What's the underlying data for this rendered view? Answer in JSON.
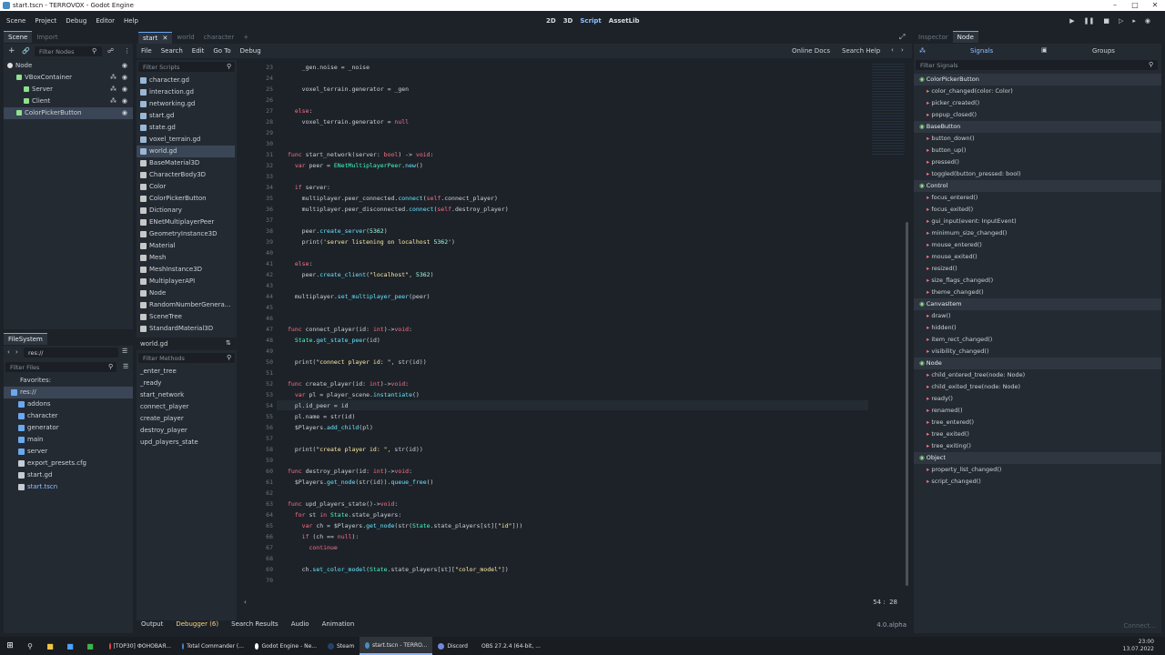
{
  "window": {
    "title": "start.tscn - TERROVOX - Godot Engine"
  },
  "menu": {
    "items": [
      "Scene",
      "Project",
      "Debug",
      "Editor",
      "Help"
    ]
  },
  "modes": [
    "2D",
    "3D",
    "Script",
    "AssetLib"
  ],
  "scene_dock": {
    "tabs": [
      "Scene",
      "Import"
    ],
    "filter_placeholder": "Filter Nodes",
    "nodes": [
      "Node",
      "VBoxContainer",
      "Server",
      "Client",
      "ColorPickerButton"
    ]
  },
  "filesystem": {
    "title": "FileSystem",
    "path": "res://",
    "filter_placeholder": "Filter Files",
    "items": [
      "Favorites:",
      "res://",
      "addons",
      "character",
      "generator",
      "main",
      "server",
      "export_presets.cfg",
      "start.gd",
      "start.tscn"
    ]
  },
  "editor_tabs": [
    "start",
    "world",
    "character"
  ],
  "script_menu": [
    "File",
    "Search",
    "Edit",
    "Go To",
    "Debug"
  ],
  "script_links": {
    "docs": "Online Docs",
    "help": "Search Help"
  },
  "script_list": {
    "filter_placeholder": "Filter Scripts",
    "items": [
      "character.gd",
      "interaction.gd",
      "networking.gd",
      "start.gd",
      "state.gd",
      "voxel_terrain.gd",
      "world.gd",
      "BaseMaterial3D",
      "CharacterBody3D",
      "Color",
      "ColorPickerButton",
      "Dictionary",
      "ENetMultiplayerPeer",
      "GeometryInstance3D",
      "Material",
      "Mesh",
      "MeshInstance3D",
      "MultiplayerAPI",
      "Node",
      "RandomNumberGenera...",
      "SceneTree",
      "StandardMaterial3D"
    ],
    "current": "world.gd"
  },
  "method_list": {
    "filter_placeholder": "Filter Methods",
    "items": [
      "_enter_tree",
      "_ready",
      "start_network",
      "connect_player",
      "create_player",
      "destroy_player",
      "upd_players_state"
    ]
  },
  "code": {
    "lines": [
      {
        "n": "23",
        "t": "    _gen.noise = _noise"
      },
      {
        "n": "24",
        "t": ""
      },
      {
        "n": "25",
        "t": "    voxel_terrain.generator = _gen"
      },
      {
        "n": "26",
        "t": ""
      },
      {
        "n": "27",
        "t": "  else:"
      },
      {
        "n": "28",
        "t": "    voxel_terrain.generator = null"
      },
      {
        "n": "29",
        "t": ""
      },
      {
        "n": "30",
        "t": ""
      },
      {
        "n": "31",
        "t": "func start_network(server: bool) -> void:"
      },
      {
        "n": "32",
        "t": "  var peer = ENetMultiplayerPeer.new()"
      },
      {
        "n": "33",
        "t": ""
      },
      {
        "n": "34",
        "t": "  if server:"
      },
      {
        "n": "35",
        "t": "    multiplayer.peer_connected.connect(self.connect_player)"
      },
      {
        "n": "36",
        "t": "    multiplayer.peer_disconnected.connect(self.destroy_player)"
      },
      {
        "n": "37",
        "t": ""
      },
      {
        "n": "38",
        "t": "    peer.create_server(5362)"
      },
      {
        "n": "39",
        "t": "    print('server listening on localhost 5362')"
      },
      {
        "n": "40",
        "t": ""
      },
      {
        "n": "41",
        "t": "  else:"
      },
      {
        "n": "42",
        "t": "    peer.create_client(\"localhost\", 5362)"
      },
      {
        "n": "43",
        "t": ""
      },
      {
        "n": "44",
        "t": "  multiplayer.set_multiplayer_peer(peer)"
      },
      {
        "n": "45",
        "t": ""
      },
      {
        "n": "46",
        "t": ""
      },
      {
        "n": "47",
        "t": "func connect_player(id: int)->void:"
      },
      {
        "n": "48",
        "t": "  State.get_state_peer(id)"
      },
      {
        "n": "49",
        "t": ""
      },
      {
        "n": "50",
        "t": "  print(\"connect player id: \", str(id))"
      },
      {
        "n": "51",
        "t": ""
      },
      {
        "n": "52",
        "t": "func create_player(id: int)->void:"
      },
      {
        "n": "53",
        "t": "  var pl = player_scene.instantiate()"
      },
      {
        "n": "54",
        "t": "  pl.id_peer = id"
      },
      {
        "n": "55",
        "t": "  pl.name = str(id)"
      },
      {
        "n": "56",
        "t": "  $Players.add_child(pl)"
      },
      {
        "n": "57",
        "t": ""
      },
      {
        "n": "58",
        "t": "  print(\"create player id: \", str(id))"
      },
      {
        "n": "59",
        "t": ""
      },
      {
        "n": "60",
        "t": "func destroy_player(id: int)->void:"
      },
      {
        "n": "61",
        "t": "  $Players.get_node(str(id)).queue_free()"
      },
      {
        "n": "62",
        "t": ""
      },
      {
        "n": "63",
        "t": "func upd_players_state()->void:"
      },
      {
        "n": "64",
        "t": "  for st in State.state_players:"
      },
      {
        "n": "65",
        "t": "    var ch = $Players.get_node(str(State.state_players[st][\"id\"]))"
      },
      {
        "n": "66",
        "t": "    if (ch == null):"
      },
      {
        "n": "67",
        "t": "      continue"
      },
      {
        "n": "68",
        "t": ""
      },
      {
        "n": "69",
        "t": "    ch.set_color_model(State.state_players[st][\"color_model\"])"
      },
      {
        "n": "70",
        "t": ""
      }
    ],
    "cursor": "54 :  28"
  },
  "bottom_tabs": [
    "Output",
    "Debugger (6)",
    "Search Results",
    "Audio",
    "Animation"
  ],
  "version": "4.0.alpha",
  "inspector": {
    "tabs": [
      "Inspector",
      "Node"
    ],
    "subtabs": [
      "Signals",
      "Groups"
    ],
    "filter_placeholder": "Filter Signals",
    "groups": [
      {
        "name": "ColorPickerButton",
        "signals": [
          "color_changed(color: Color)",
          "picker_created()",
          "popup_closed()"
        ]
      },
      {
        "name": "BaseButton",
        "signals": [
          "button_down()",
          "button_up()",
          "pressed()",
          "toggled(button_pressed: bool)"
        ]
      },
      {
        "name": "Control",
        "signals": [
          "focus_entered()",
          "focus_exited()",
          "gui_input(event: InputEvent)",
          "minimum_size_changed()",
          "mouse_entered()",
          "mouse_exited()",
          "resized()",
          "size_flags_changed()",
          "theme_changed()"
        ]
      },
      {
        "name": "CanvasItem",
        "signals": [
          "draw()",
          "hidden()",
          "item_rect_changed()",
          "visibility_changed()"
        ]
      },
      {
        "name": "Node",
        "signals": [
          "child_entered_tree(node: Node)",
          "child_exited_tree(node: Node)",
          "ready()",
          "renamed()",
          "tree_entered()",
          "tree_exited()",
          "tree_exiting()"
        ]
      },
      {
        "name": "Object",
        "signals": [
          "property_list_changed()",
          "script_changed()"
        ]
      }
    ],
    "connect_label": "Connect..."
  },
  "taskbar": {
    "apps": [
      "[ТОР30] ФОНОВАЯ...",
      "Total Commander (...",
      "Godot Engine - Ne...",
      "Steam",
      "start.tscn - TERRO...",
      "Discord",
      "OBS 27.2.4 (64-bit, ..."
    ],
    "time": "23:00",
    "date": "13.07.2022"
  }
}
